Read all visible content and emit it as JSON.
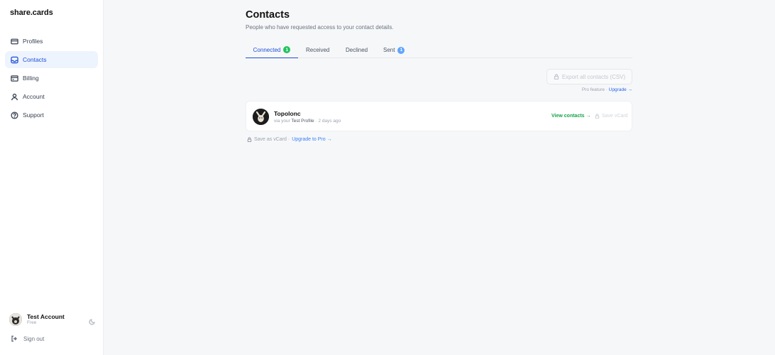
{
  "app": {
    "logo": "share.cards"
  },
  "sidebar": {
    "items": [
      {
        "label": "Profiles",
        "icon": "card-icon",
        "active": false
      },
      {
        "label": "Contacts",
        "icon": "inbox-icon",
        "active": true
      },
      {
        "label": "Billing",
        "icon": "credit-card-icon",
        "active": false
      },
      {
        "label": "Account",
        "icon": "user-icon",
        "active": false
      },
      {
        "label": "Support",
        "icon": "help-circle-icon",
        "active": false
      }
    ],
    "user": {
      "name": "Test Account",
      "plan": "Free"
    },
    "signout_label": "Sign out"
  },
  "page": {
    "title": "Contacts",
    "subtitle": "People who have requested access to your contact details."
  },
  "tabs": [
    {
      "label": "Connected",
      "badge": "1",
      "badge_color": "#22c55e",
      "active": true
    },
    {
      "label": "Received",
      "badge": "",
      "active": false
    },
    {
      "label": "Declined",
      "badge": "",
      "active": false
    },
    {
      "label": "Sent",
      "badge": "1",
      "badge_color": "#60a5fa",
      "active": false
    }
  ],
  "export": {
    "button_label": "Export all contacts (CSV)",
    "note_prefix": "Pro feature · ",
    "note_link": "Upgrade →"
  },
  "contacts": [
    {
      "name": "Topolonc",
      "via_prefix": "via your ",
      "profile": "Test Profile",
      "time": " · 2 days ago",
      "view_label": "View contacts →",
      "save_label": "Save vCard"
    }
  ],
  "footnote": {
    "text": "Save as vCard ·",
    "link": "Upgrade to Pro →"
  },
  "colors": {
    "accent": "#1d4ed8",
    "success": "#16a34a",
    "active_bg": "#eef4fe"
  }
}
